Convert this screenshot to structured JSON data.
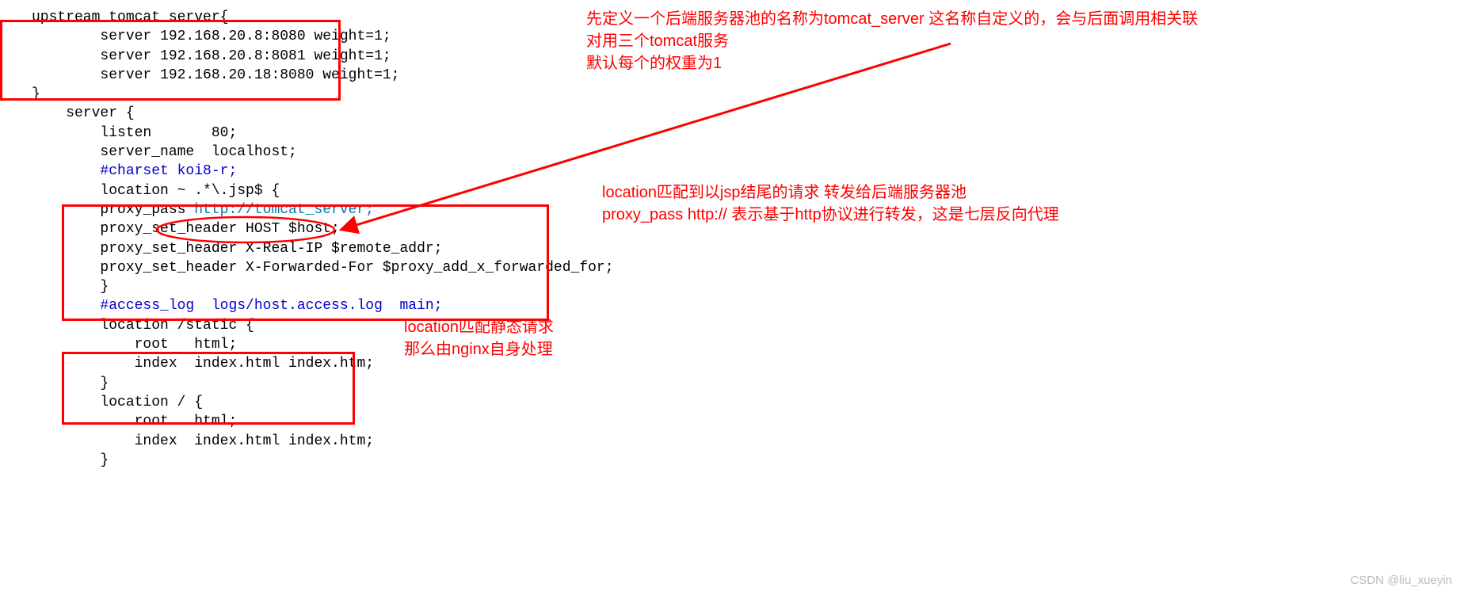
{
  "code": {
    "upstream_open": "upstream tomcat_server{",
    "upstream_s1": "        server 192.168.20.8:8080 weight=1;",
    "upstream_s2": "        server 192.168.20.8:8081 weight=1;",
    "upstream_s3": "        server 192.168.20.18:8080 weight=1;",
    "upstream_close": "}",
    "server_open": "    server {",
    "listen": "        listen       80;",
    "server_name": "        server_name  localhost;",
    "charset": "        #charset koi8-r;",
    "loc_jsp": "        location ~ .*\\.jsp$ {",
    "proxy_pass_pre": "        proxy_pass ",
    "proxy_pass_url": "http://tomcat_server;",
    "proxy_h1": "        proxy_set_header HOST $host;",
    "proxy_h2": "        proxy_set_header X-Real-IP $remote_addr;",
    "proxy_h3": "        proxy_set_header X-Forwarded-For $proxy_add_x_forwarded_for;",
    "loc_jsp_close": "        }",
    "access_log": "        #access_log  logs/host.access.log  main;",
    "loc_static_open": "        location /static {",
    "root": "            root   html;",
    "index": "            index  index.html index.htm;",
    "loc_static_close": "        }",
    "loc_root_open": "        location / {",
    "loc_root_close": "        }"
  },
  "annotations": {
    "a1_l1": "先定义一个后端服务器池的名称为tomcat_server 这名称自定义的，会与后面调用相关联",
    "a1_l2": "对用三个tomcat服务",
    "a1_l3": "默认每个的权重为1",
    "a2_l1": "location匹配到以jsp结尾的请求 转发给后端服务器池",
    "a2_l2": "proxy_pass http:// 表示基于http协议进行转发，这是七层反向代理",
    "a3_l1": "location匹配静态请求",
    "a3_l2": "那么由nginx自身处理"
  },
  "watermark": "CSDN @liu_xueyin"
}
